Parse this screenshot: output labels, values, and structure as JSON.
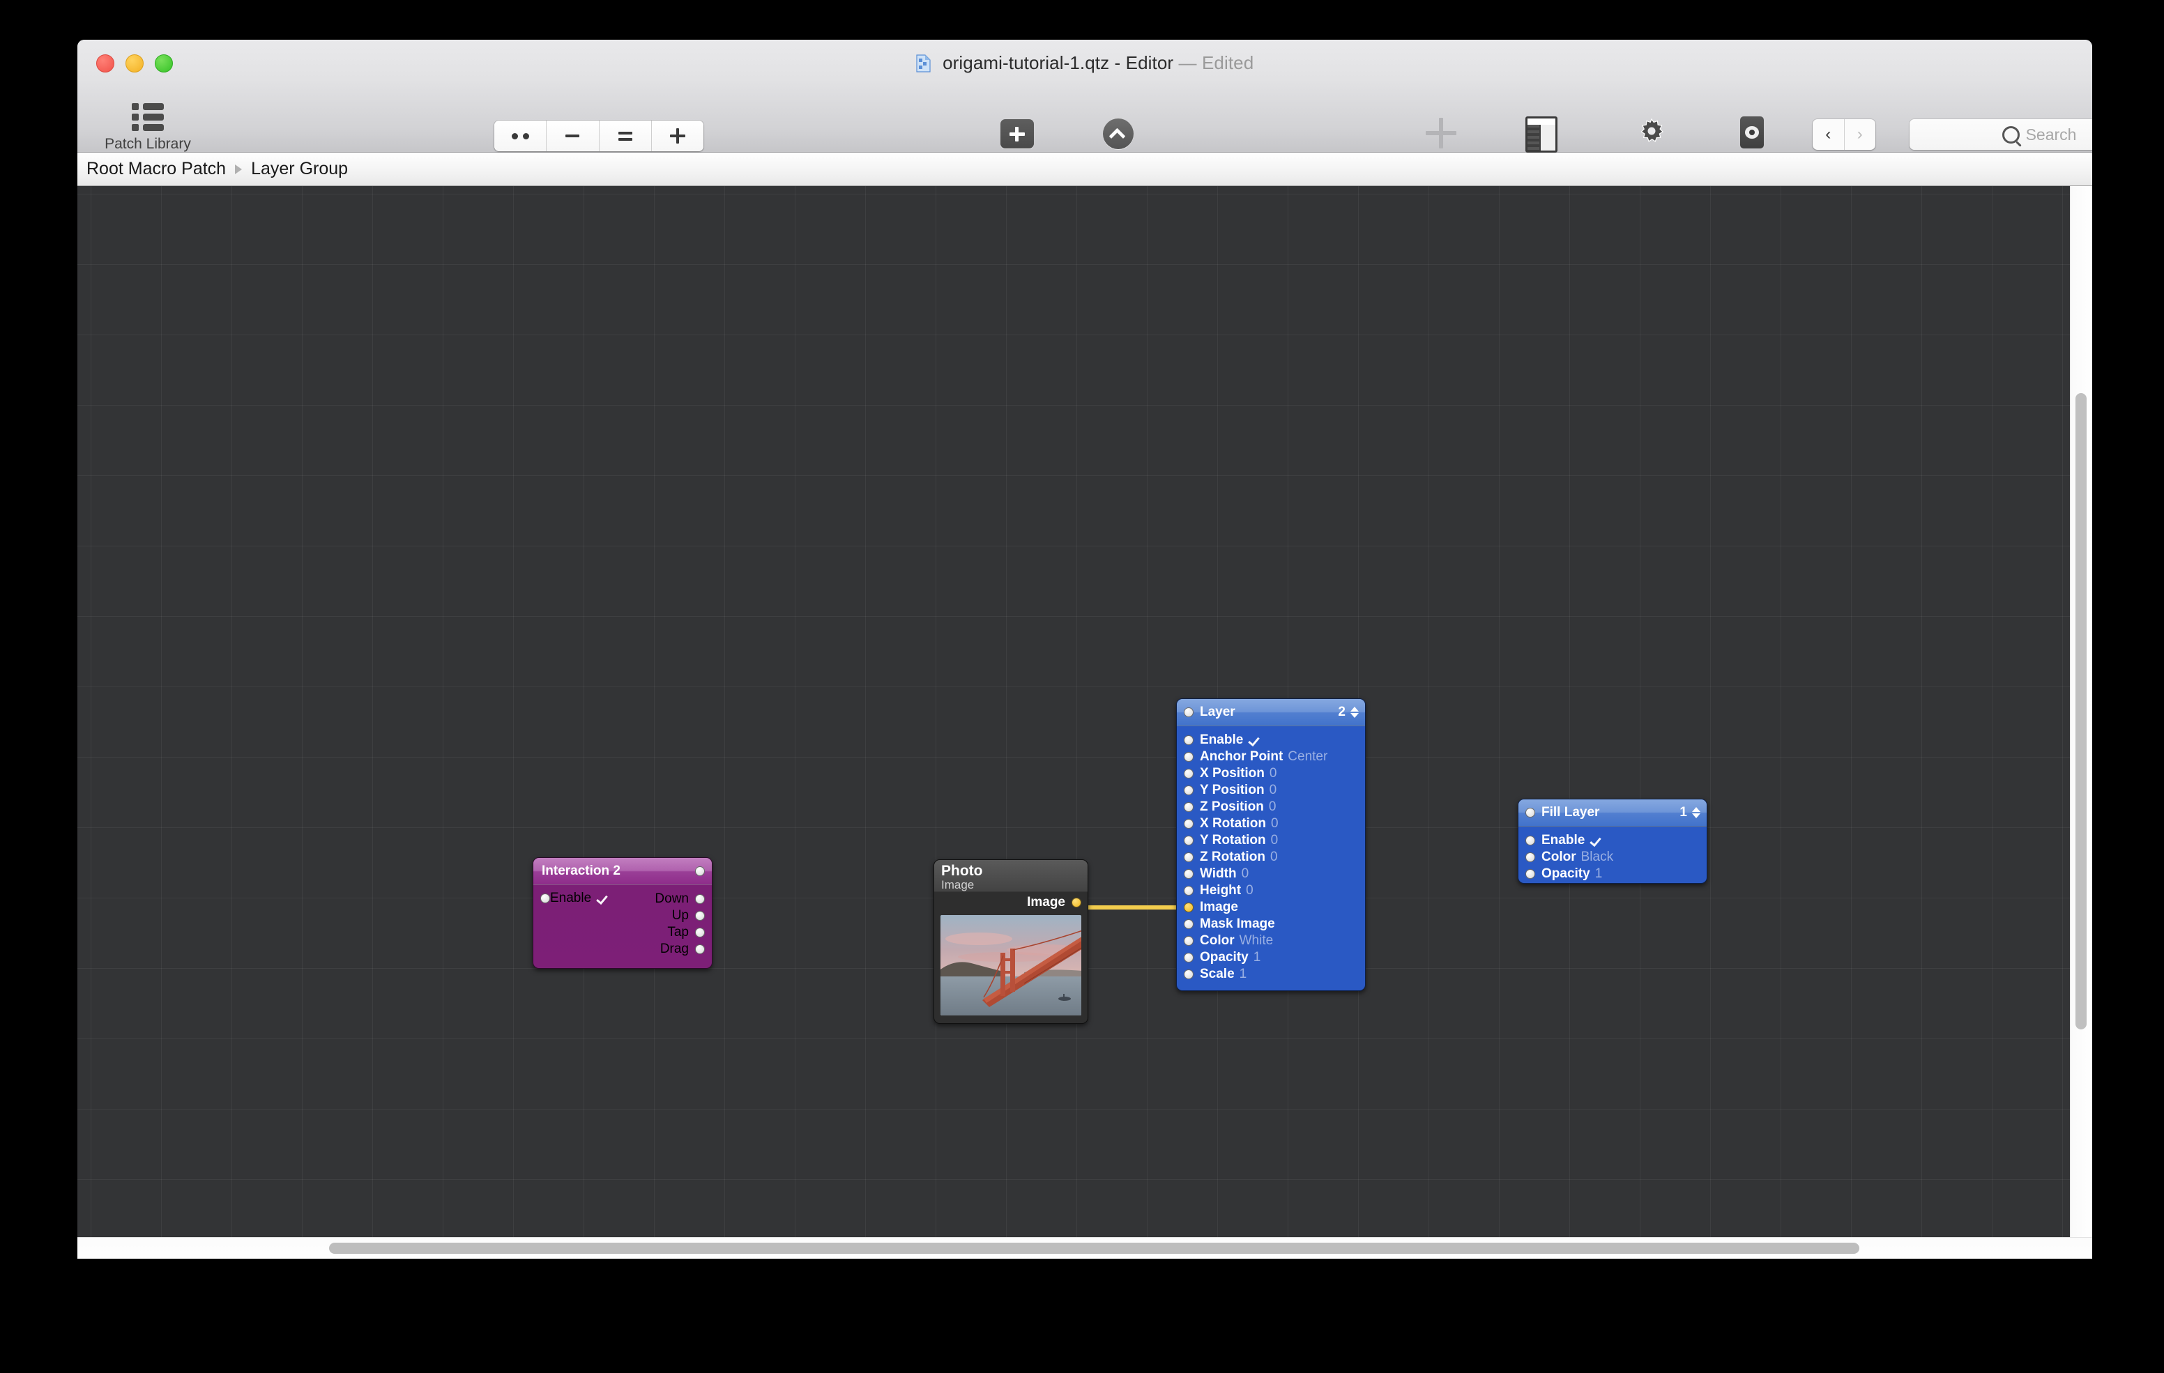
{
  "window": {
    "title_filename": "origami-tutorial-1.qtz - Editor",
    "title_dash": "—",
    "title_state": "Edited",
    "doc_icon": "quartz-composer-document-icon"
  },
  "traffic_lights": [
    {
      "name": "close-button",
      "color": "#f0524a"
    },
    {
      "name": "minimize-button",
      "color": "#f2b024"
    },
    {
      "name": "zoom-button",
      "color": "#36c227"
    }
  ],
  "toolbar": {
    "patch_library": {
      "label": "Patch Library",
      "icon": "list-icon",
      "enabled": true
    },
    "zoom_levels": {
      "label": "Zoom Levels",
      "buttons": [
        {
          "name": "zoom-fit-button",
          "icon": "two-dots-icon"
        },
        {
          "name": "zoom-out-button",
          "icon": "minus-icon"
        },
        {
          "name": "zoom-actual-button",
          "icon": "equals-icon"
        },
        {
          "name": "zoom-in-button",
          "icon": "plus-icon"
        }
      ]
    },
    "create_macro": {
      "label": "Create Macro",
      "icon": "plus-square-icon",
      "enabled": true
    },
    "edit_parent": {
      "label": "Edit Parent",
      "icon": "chevron-up-circle-icon",
      "enabled": true
    },
    "add_to_library": {
      "label": "Add to Library",
      "icon": "plus-icon",
      "enabled": false
    },
    "parameters": {
      "label": "Parameters",
      "icon": "panel-icon",
      "enabled": true
    },
    "patch_inspector": {
      "label": "Patch Inspector",
      "icon": "gear-icon",
      "enabled": true
    },
    "viewer": {
      "label": "Viewer",
      "icon": "eye-icon",
      "enabled": true
    },
    "back_forward": {
      "label": "Back/Forward",
      "back_glyph": "‹",
      "forward_glyph": "›",
      "back_enabled": true,
      "forward_enabled": false
    },
    "search": {
      "label": "Search",
      "placeholder": "Search",
      "value": "",
      "icon": "search-icon"
    }
  },
  "breadcrumb": {
    "items": [
      "Root Macro Patch",
      "Layer Group"
    ],
    "separator": "▶"
  },
  "canvas": {
    "background": "#333436",
    "grid_color": "rgba(255,255,255,0.055)",
    "grid_size": 101
  },
  "nodes": {
    "interaction": {
      "title": "Interaction 2",
      "color": "#7d1f77",
      "inputs": [
        {
          "label": "Enable",
          "value": "",
          "checked": true
        }
      ],
      "outputs": [
        {
          "label": "Down"
        },
        {
          "label": "Up"
        },
        {
          "label": "Tap"
        },
        {
          "label": "Drag"
        }
      ]
    },
    "photo": {
      "title": "Photo",
      "subtitle": "Image",
      "color": "#2e2e2e",
      "outputs": [
        {
          "label": "Image",
          "connected": true
        }
      ],
      "thumbnail": "golden-gate-bridge-photo"
    },
    "layer": {
      "title": "Layer",
      "color": "#2a59c4",
      "index": "2",
      "ports": [
        {
          "label": "Enable",
          "value": "",
          "checked": true,
          "connected": false
        },
        {
          "label": "Anchor Point",
          "value": "Center",
          "connected": false
        },
        {
          "label": "X Position",
          "value": "0",
          "connected": false
        },
        {
          "label": "Y Position",
          "value": "0",
          "connected": false
        },
        {
          "label": "Z Position",
          "value": "0",
          "connected": false
        },
        {
          "label": "X Rotation",
          "value": "0",
          "connected": false
        },
        {
          "label": "Y Rotation",
          "value": "0",
          "connected": false
        },
        {
          "label": "Z Rotation",
          "value": "0",
          "connected": false
        },
        {
          "label": "Width",
          "value": "0",
          "connected": false
        },
        {
          "label": "Height",
          "value": "0",
          "connected": false
        },
        {
          "label": "Image",
          "value": "",
          "connected": true
        },
        {
          "label": "Mask Image",
          "value": "",
          "connected": false
        },
        {
          "label": "Color",
          "value": "White",
          "connected": false
        },
        {
          "label": "Opacity",
          "value": "1",
          "connected": false
        },
        {
          "label": "Scale",
          "value": "1",
          "connected": false
        }
      ]
    },
    "fill_layer": {
      "title": "Fill Layer",
      "color": "#2a59c4",
      "index": "1",
      "ports": [
        {
          "label": "Enable",
          "value": "",
          "checked": true
        },
        {
          "label": "Color",
          "value": "Black"
        },
        {
          "label": "Opacity",
          "value": "1"
        }
      ]
    }
  },
  "connections": [
    {
      "from": "photo.Image",
      "to": "layer.Image",
      "color": "#f3cd4e"
    }
  ],
  "scrollbars": {
    "vertical": {
      "name": "vertical-scrollbar"
    },
    "horizontal": {
      "name": "horizontal-scrollbar"
    }
  }
}
